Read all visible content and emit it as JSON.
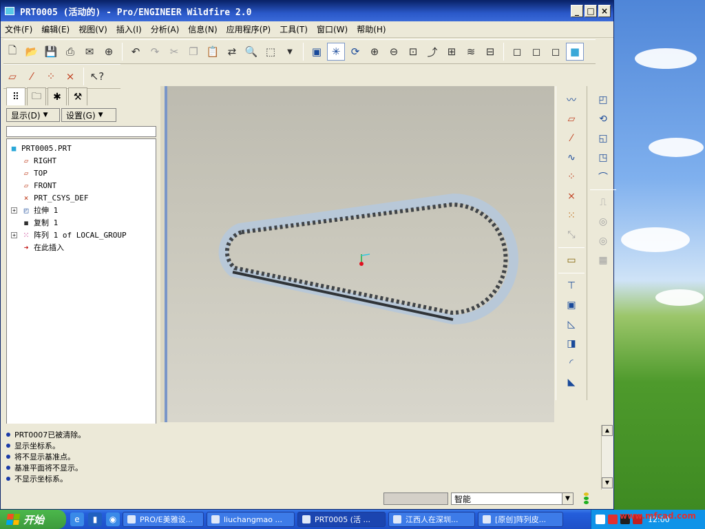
{
  "window": {
    "title": "PRT0005 (活动的) - Pro/ENGINEER Wildfire 2.0",
    "buttons": [
      "_",
      "□",
      "×"
    ]
  },
  "menu": [
    "文件(F)",
    "编辑(E)",
    "视图(V)",
    "插入(I)",
    "分析(A)",
    "信息(N)",
    "应用程序(P)",
    "工具(T)",
    "窗口(W)",
    "帮助(H)"
  ],
  "model_tree": {
    "options": {
      "show": "显示(D)",
      "settings": "设置(G)"
    },
    "nodes": [
      {
        "label": "PRT0005.PRT",
        "icon": "part-icon"
      },
      {
        "label": "RIGHT",
        "icon": "datum-plane-icon"
      },
      {
        "label": "TOP",
        "icon": "datum-plane-icon"
      },
      {
        "label": "FRONT",
        "icon": "datum-plane-icon"
      },
      {
        "label": "PRT_CSYS_DEF",
        "icon": "coordinate-system-icon"
      },
      {
        "label": "拉伸 1",
        "icon": "extrude-icon"
      },
      {
        "label": "复制 1",
        "icon": "copy-feature-icon"
      },
      {
        "label": "阵列 1 of LOCAL_GROUP",
        "icon": "pattern-icon"
      },
      {
        "label": "在此插入",
        "icon": "insert-here-arrow-icon"
      }
    ]
  },
  "messages": [
    "PRT0007已被清除。",
    "显示坐标系。",
    "将不显示基准点。",
    "基准平面将不显示。",
    "不显示坐标系。"
  ],
  "status": {
    "filter_value": "智能"
  },
  "taskbar": {
    "start_label": "开始",
    "tasks": [
      "PRO/E美雅设...",
      "liuchangmao ...",
      "PRT0005 (活 ...",
      "江西人在深圳...",
      "[原创]阵列皮..."
    ],
    "clock": "12:00",
    "watermark": "www.mfcad.com"
  },
  "colors": {
    "title_bar": "#0a246a",
    "graphics_bg": "#c8c6ba",
    "belt_outer": "#b8c8d8",
    "belt_teeth": "#404448",
    "accent_blue": "#1a4a9a"
  }
}
